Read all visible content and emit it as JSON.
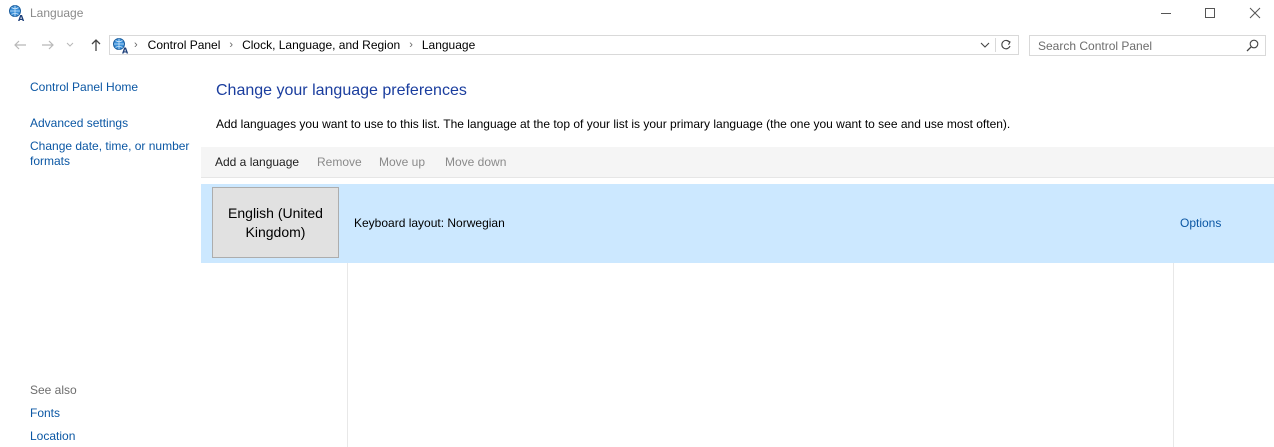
{
  "window": {
    "title": "Language"
  },
  "address": {
    "crumbs": [
      "Control Panel",
      "Clock, Language, and Region",
      "Language"
    ]
  },
  "search": {
    "placeholder": "Search Control Panel"
  },
  "leftnav": {
    "home": "Control Panel Home",
    "advanced": "Advanced settings",
    "change_date_line1": "Change date, time, or number",
    "change_date_line2": "formats",
    "see_also": "See also",
    "fonts": "Fonts",
    "location": "Location"
  },
  "main": {
    "heading": "Change your language preferences",
    "description": "Add languages you want to use to this list. The language at the top of your list is your primary language (the one you want to see and use most often).",
    "toolbar": {
      "add": "Add a language",
      "remove": "Remove",
      "move_up": "Move up",
      "move_down": "Move down"
    },
    "languages": [
      {
        "name": "English (United Kingdom)",
        "keyboard": "Keyboard layout: Norwegian",
        "options": "Options"
      }
    ]
  },
  "colors": {
    "link": "#0b57a4",
    "heading": "#1a3d9e",
    "selected_row": "#cce8ff",
    "toolbar_bg": "#f5f5f5"
  }
}
